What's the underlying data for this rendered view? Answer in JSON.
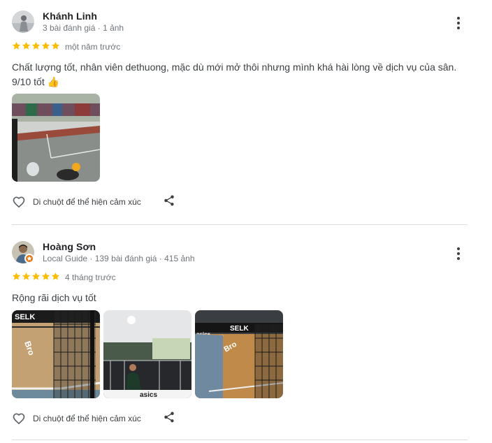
{
  "reviews": [
    {
      "name": "Khánh Linh",
      "meta": "3 bài đánh giá · 1 ảnh",
      "rating": 5,
      "time": "một năm trước",
      "text": "Chất lượng tốt, nhân viên dethuong, mặc dù mới mở thôi nhưng mình khá hài lòng về dịch vụ của sân. 9/10 tốt 👍",
      "photo_count": 1,
      "react_label": "Di chuột để thể hiện cảm xúc"
    },
    {
      "name": "Hoàng Sơn",
      "meta": "Local Guide · 139 bài đánh giá · 415 ảnh",
      "rating": 5,
      "time": "4 tháng trước",
      "text": "Rộng rãi dịch vụ tốt",
      "photo_count": 3,
      "react_label": "Di chuột để thể hiện cảm xúc"
    }
  ],
  "photo_lettering": [
    "SELK",
    "asics",
    "Bro"
  ],
  "colors": {
    "star": "#fbbc04",
    "local_guide_badge": "#e8710a",
    "divider": "#dadce0",
    "secondary_text": "#70757a"
  },
  "icons": [
    "more-vertical-icon",
    "star-icon",
    "heart-outline-icon",
    "share-icon",
    "local-guide-badge-icon"
  ]
}
